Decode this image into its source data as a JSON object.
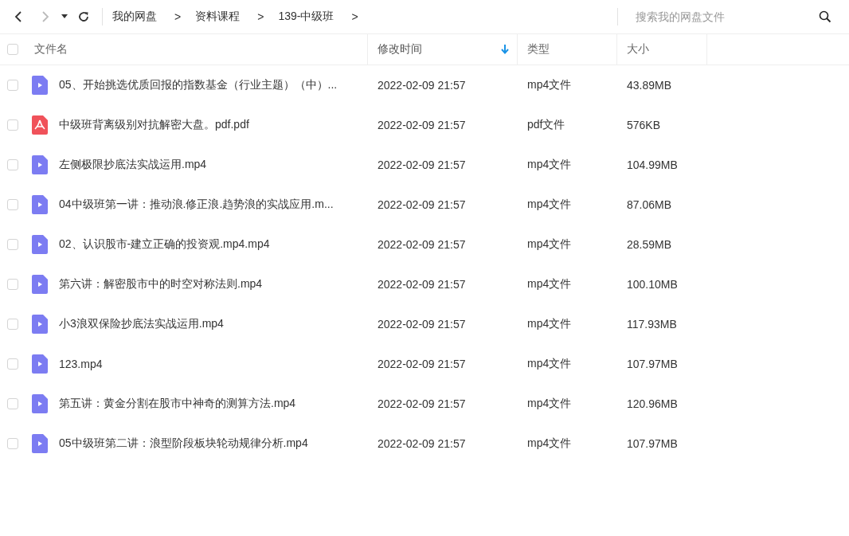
{
  "toolbar": {
    "back_disabled": false,
    "forward_disabled": true,
    "breadcrumbs": [
      {
        "label": "我的网盘",
        "separator": ">"
      },
      {
        "label": "资料课程",
        "separator": ">"
      },
      {
        "label": "139-中级班",
        "separator": ">"
      }
    ],
    "search": {
      "placeholder": "搜索我的网盘文件"
    }
  },
  "table": {
    "select_all": {
      "checked": false
    },
    "columns": [
      {
        "label": "文件名",
        "sorted": false
      },
      {
        "label": "修改时间",
        "sorted": true
      },
      {
        "label": "类型",
        "sorted": false
      },
      {
        "label": "大小",
        "sorted": false
      }
    ],
    "rows": [
      {
        "kind": "video",
        "checked": false,
        "name": "05、开始挑选优质回报的指数基金（行业主题）（中）...",
        "modified": "2022-02-09 21:57",
        "type": "mp4文件",
        "size": "43.89MB"
      },
      {
        "kind": "pdf",
        "checked": false,
        "name": "中级班背离级别对抗解密大盘。pdf.pdf",
        "modified": "2022-02-09 21:57",
        "type": "pdf文件",
        "size": "576KB"
      },
      {
        "kind": "video",
        "checked": false,
        "name": "左侧极限抄底法实战运用.mp4",
        "modified": "2022-02-09 21:57",
        "type": "mp4文件",
        "size": "104.99MB"
      },
      {
        "kind": "video",
        "checked": false,
        "name": "04中级班第一讲：推动浪.修正浪.趋势浪的实战应用.m...",
        "modified": "2022-02-09 21:57",
        "type": "mp4文件",
        "size": "87.06MB"
      },
      {
        "kind": "video",
        "checked": false,
        "name": "02、认识股市-建立正确的投资观.mp4.mp4",
        "modified": "2022-02-09 21:57",
        "type": "mp4文件",
        "size": "28.59MB"
      },
      {
        "kind": "video",
        "checked": false,
        "name": "第六讲：解密股市中的时空对称法则.mp4",
        "modified": "2022-02-09 21:57",
        "type": "mp4文件",
        "size": "100.10MB"
      },
      {
        "kind": "video",
        "checked": false,
        "name": "小3浪双保险抄底法实战运用.mp4",
        "modified": "2022-02-09 21:57",
        "type": "mp4文件",
        "size": "117.93MB"
      },
      {
        "kind": "video",
        "checked": false,
        "name": "123.mp4",
        "modified": "2022-02-09 21:57",
        "type": "mp4文件",
        "size": "107.97MB"
      },
      {
        "kind": "video",
        "checked": false,
        "name": "第五讲：黄金分割在股市中神奇的测算方法.mp4",
        "modified": "2022-02-09 21:57",
        "type": "mp4文件",
        "size": "120.96MB"
      },
      {
        "kind": "video",
        "checked": false,
        "name": "05中级班第二讲：浪型阶段板块轮动规律分析.mp4",
        "modified": "2022-02-09 21:57",
        "type": "mp4文件",
        "size": "107.97MB"
      }
    ]
  }
}
